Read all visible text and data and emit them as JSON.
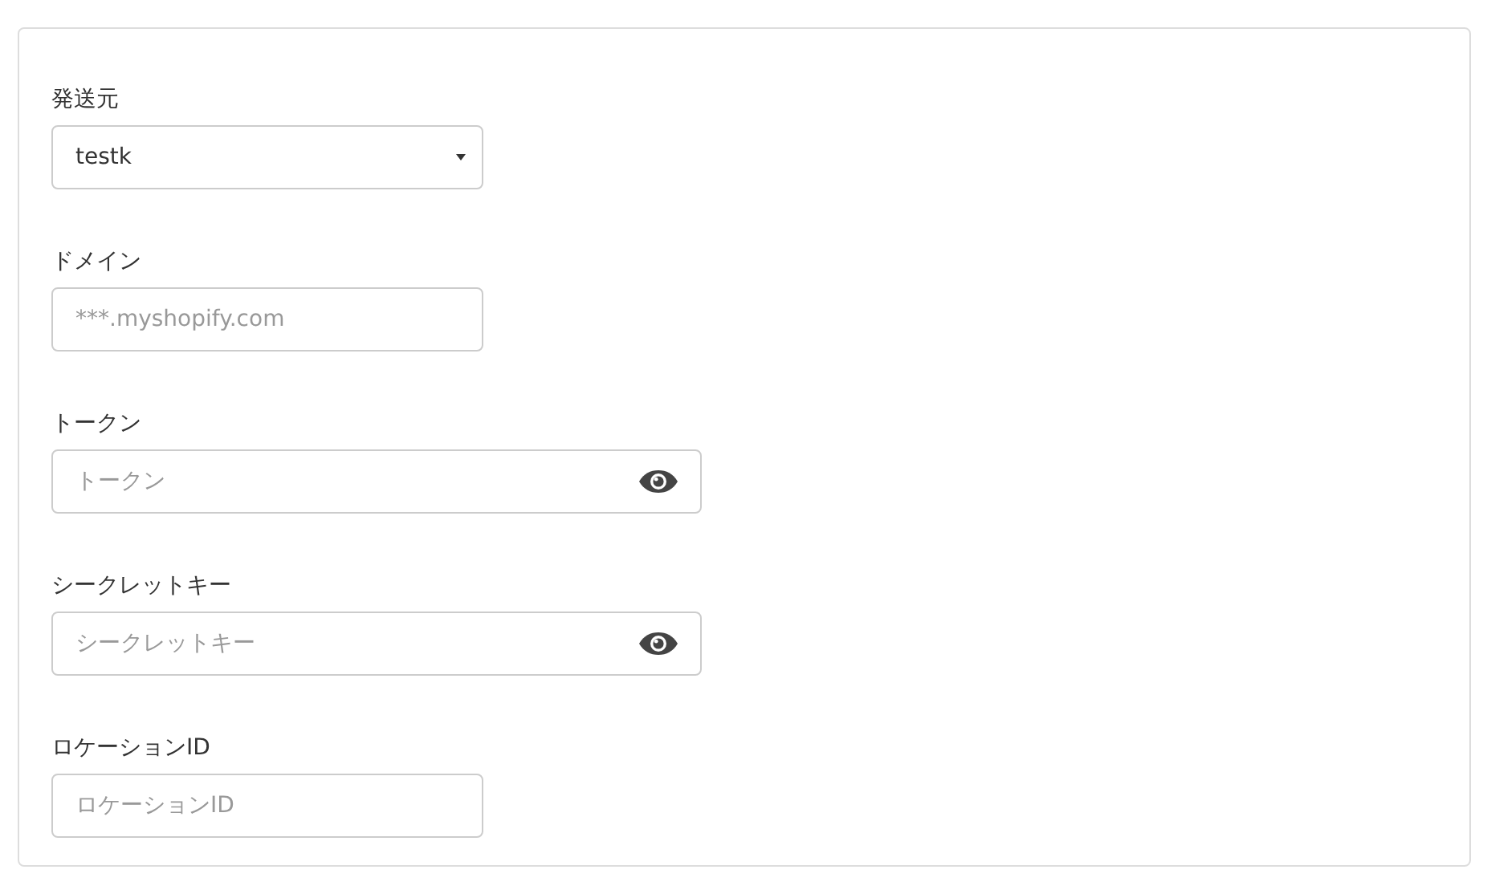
{
  "fields": [
    {
      "kind": "select",
      "label": "発送元",
      "value": "testk"
    },
    {
      "kind": "text",
      "label": "ドメイン",
      "placeholder": "***.myshopify.com"
    },
    {
      "kind": "secret",
      "label": "トークン",
      "placeholder": "トークン"
    },
    {
      "kind": "secret",
      "label": "シークレットキー",
      "placeholder": "シークレットキー"
    },
    {
      "kind": "text",
      "label": "ロケーションID",
      "placeholder": "ロケーションID"
    }
  ]
}
